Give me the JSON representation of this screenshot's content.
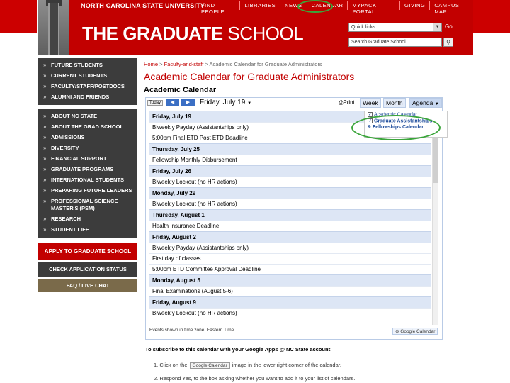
{
  "header": {
    "university": "NORTH CAROLINA STATE UNIVERSITY",
    "top_nav": [
      "FIND PEOPLE",
      "LIBRARIES",
      "NEWS",
      "CALENDAR",
      "MYPACK PORTAL",
      "GIVING",
      "CAMPUS MAP"
    ],
    "title_main": "THE GRADUATE",
    "title_rest": " SCHOOL",
    "quick_links": "Quick links",
    "go": "Go",
    "search_placeholder": "Search Graduate School"
  },
  "sidebar": {
    "group1": [
      "FUTURE STUDENTS",
      "CURRENT STUDENTS",
      "FACULTY/STAFF/POSTDOCS",
      "ALUMNI AND FRIENDS"
    ],
    "group2": [
      "ABOUT NC STATE",
      "ABOUT THE GRAD SCHOOL",
      "ADMISSIONS",
      "DIVERSITY",
      "FINANCIAL SUPPORT",
      "GRADUATE PROGRAMS",
      "INTERNATIONAL STUDENTS",
      "PREPARING FUTURE LEADERS",
      "PROFESSIONAL SCIENCE MASTER'S (PSM)",
      "RESEARCH",
      "STUDENT LIFE"
    ],
    "apply": "APPLY TO GRADUATE SCHOOL",
    "check": "CHECK APPLICATION STATUS",
    "faq": "FAQ / LIVE CHAT"
  },
  "content": {
    "crumb_home": "Home",
    "crumb_faculty": "Faculty-and-staff",
    "crumb_current": " > Academic Calendar for Graduate Administrators",
    "crumb_sep": " > ",
    "page_title": "Academic Calendar for Graduate Administrators",
    "cal_heading": "Academic Calendar"
  },
  "calendar": {
    "today": "Today",
    "date_range": "Friday, July 19",
    "print": "Print",
    "tabs": [
      "Week",
      "Month",
      "Agenda"
    ],
    "days": [
      {
        "date": "Friday, July 19",
        "events": [
          "Biweekly Payday (Assistantships only)",
          "5:00pm  Final ETD Post ETD Deadline"
        ]
      },
      {
        "date": "Thursday, July 25",
        "events": [
          "Fellowship Monthly Disbursement"
        ]
      },
      {
        "date": "Friday, July 26",
        "events": [
          "Biweekly Lockout (no HR actions)"
        ]
      },
      {
        "date": "Monday, July 29",
        "events": [
          "Biweekly Lockout (no HR actions)"
        ]
      },
      {
        "date": "Thursday, August 1",
        "events": [
          "Health Insurance Deadline"
        ]
      },
      {
        "date": "Friday, August 2",
        "events": [
          "Biweekly Payday (Assistantships only)",
          "First day of classes",
          "5:00pm  ETD Committee Approval Deadline"
        ]
      },
      {
        "date": "Monday, August 5",
        "events": [
          "Final Examinations (August 5-6)"
        ]
      },
      {
        "date": "Friday, August 9",
        "events": [
          "Biweekly Lockout (no HR actions)"
        ]
      }
    ],
    "popup": {
      "item1": "Academic Calendar",
      "item2_line1": "Graduate Assistantships",
      "item2_line2": "& Fellowships Calendar"
    },
    "footer": "Events shown in time zone: Eastern Time",
    "gcal": "Google Calendar"
  },
  "subscribe": {
    "heading": "To subscribe to this calendar with your Google Apps @ NC State account:",
    "step1_pre": "1.  Click on the",
    "step1_btn": "Google Calendar",
    "step1_post": "image in the lower right corner of the calendar.",
    "step2": "2.  Respond Yes, to the box asking whether you want to add it to your list of calendars."
  },
  "colors": {
    "brand_red": "#c20000",
    "annotation_green": "#3aa53a"
  }
}
